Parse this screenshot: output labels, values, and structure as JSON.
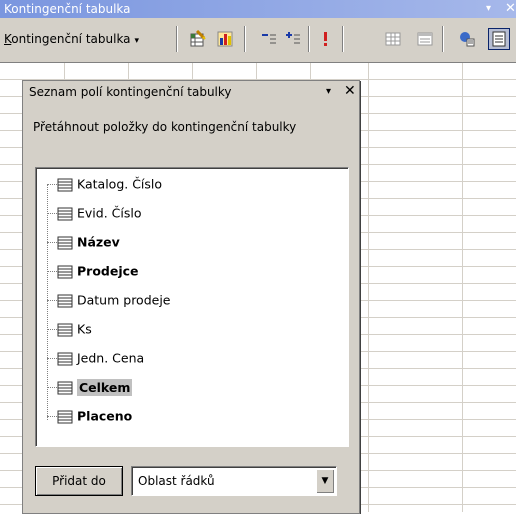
{
  "toolbar": {
    "title": "Kontingenční tabulka",
    "menu_label_accel": "K",
    "menu_label_rest": "ontingenční tabulka",
    "menu_arrow": "▾",
    "title_down": "▾",
    "title_close": "✕",
    "buttons": [
      {
        "icon": "format-report-icon"
      },
      {
        "icon": "chart-wizard-icon"
      },
      {
        "icon": "hide-detail-icon"
      },
      {
        "icon": "show-detail-icon"
      },
      {
        "icon": "refresh-data-icon"
      },
      {
        "icon": "include-hidden-items-icon"
      },
      {
        "icon": "always-display-items-icon"
      },
      {
        "icon": "field-settings-icon"
      },
      {
        "icon": "field-list-icon"
      }
    ]
  },
  "pane": {
    "title": "Seznam polí kontingenční tabulky",
    "down": "▾",
    "close": "✕",
    "description": "Přetáhnout položky do kontingenční tabulky",
    "fields": [
      {
        "label": "Katalog. Číslo",
        "bold": false,
        "selected": false
      },
      {
        "label": "Evid. Číslo",
        "bold": false,
        "selected": false
      },
      {
        "label": "Název",
        "bold": true,
        "selected": false
      },
      {
        "label": "Prodejce",
        "bold": true,
        "selected": false
      },
      {
        "label": "Datum prodeje",
        "bold": false,
        "selected": false
      },
      {
        "label": "Ks",
        "bold": false,
        "selected": false
      },
      {
        "label": "Jedn. Cena",
        "bold": false,
        "selected": false
      },
      {
        "label": "Celkem",
        "bold": true,
        "selected": true
      },
      {
        "label": "Placeno",
        "bold": true,
        "selected": false
      }
    ],
    "add_button": "Přidat do",
    "area_value": "Oblast řádků"
  },
  "colors": {
    "title_gradient_start": "#7a96df",
    "chrome": "#d4d0c8",
    "selection": "#c0c0c0"
  }
}
